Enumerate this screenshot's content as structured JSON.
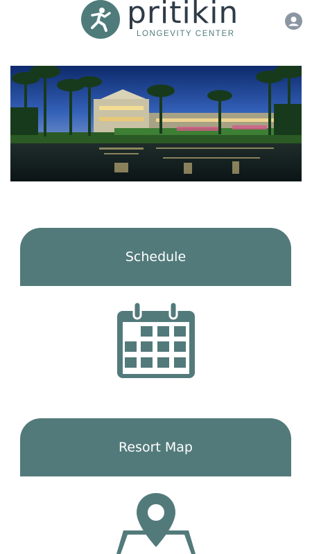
{
  "header": {
    "brand": "pritikin",
    "tagline": "LONGEVITY CENTER",
    "logo_icon": "runner-logo-icon",
    "account_icon": "user-account-icon"
  },
  "hero": {
    "image": "resort-night-photo"
  },
  "menu": [
    {
      "label": "Schedule",
      "icon": "calendar-icon"
    },
    {
      "label": "Resort Map",
      "icon": "map-pin-icon"
    }
  ],
  "colors": {
    "accent": "#537a7a",
    "brand_text": "#2f3b47",
    "account_icon": "#8c96a3"
  }
}
